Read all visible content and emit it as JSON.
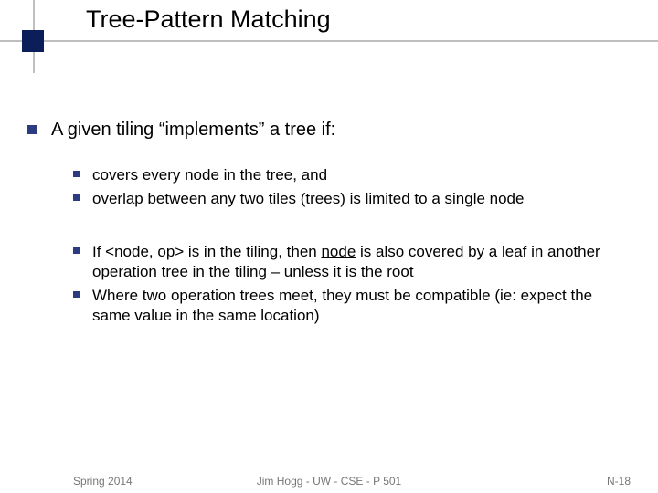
{
  "title": "Tree-Pattern Matching",
  "lead": "A given tiling “implements” a tree if:",
  "sub": {
    "a": "covers every node in the tree, and",
    "b": "overlap between any two tiles (trees) is limited to a single node",
    "c_pre": "If <node, op> is in the tiling, then ",
    "c_u": "node",
    "c_post": " is also covered by a leaf in another operation tree in the tiling – unless it is the root",
    "d": "Where two operation trees meet, they must be compatible (ie: expect the same value in the same location)"
  },
  "footer": {
    "left": "Spring 2014",
    "center": "Jim Hogg - UW - CSE - P 501",
    "right": "N-18"
  }
}
